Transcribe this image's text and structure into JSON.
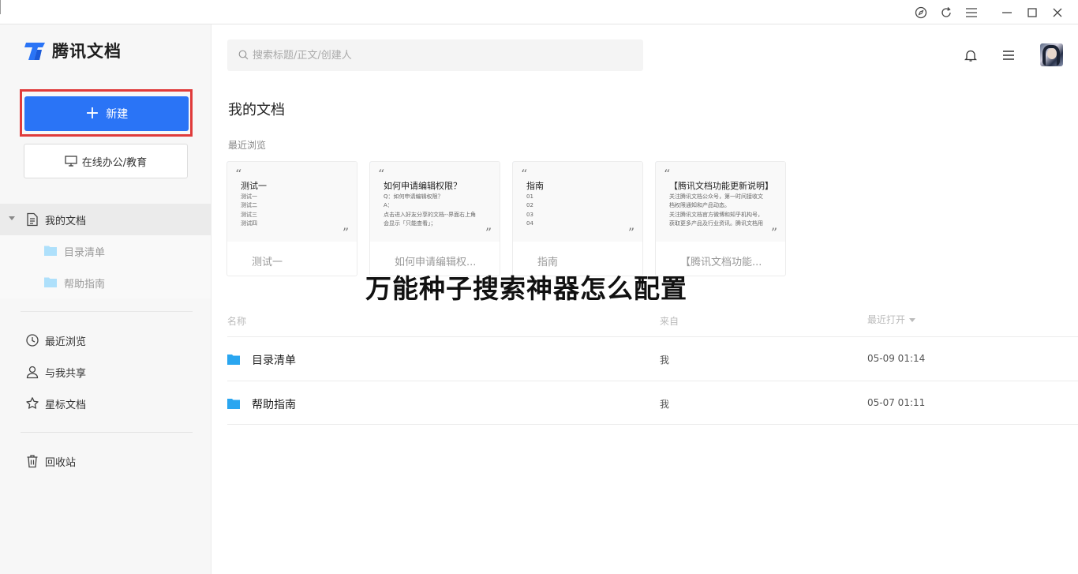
{
  "app": {
    "logo_text": "腾讯文档"
  },
  "sidebar": {
    "new_label": "新建",
    "online_label": "在线办公/教育",
    "my_docs": "我的文档",
    "folders": [
      {
        "label": "目录清单"
      },
      {
        "label": "帮助指南"
      }
    ],
    "recent": "最近浏览",
    "shared": "与我共享",
    "starred": "星标文档",
    "trash": "回收站"
  },
  "search": {
    "placeholder": "搜索标题/正文/创建人"
  },
  "main": {
    "title": "我的文档",
    "recent_label": "最近浏览",
    "cards": [
      {
        "title": "测试一",
        "lines": [
          "测试一",
          "测试二",
          "测试三",
          "测试四"
        ],
        "name": "测试一"
      },
      {
        "title": "如何申请编辑权限？",
        "lines": [
          "Q：如何申请编辑权限？",
          "A：",
          "点击进入好友分享的文档--界面右上角",
          "会显示「只能查看」；"
        ],
        "name": "如何申请编辑权..."
      },
      {
        "title": "指南",
        "lines": [
          "01",
          "02",
          "03",
          "04"
        ],
        "name": "指南"
      },
      {
        "title": "【腾讯文档功能更新说明】",
        "lines": [
          "关注腾讯文档公众号，第一时间接收文",
          "档权限通知和产品动态。",
          "关注腾讯文档官方微博和知乎机构号，",
          "获取更多产品及行业资讯。腾讯文档用"
        ],
        "name": "【腾讯文档功能..."
      }
    ],
    "overlay_text": "万能种子搜索神器怎么配置",
    "columns": {
      "name": "名称",
      "source": "来自",
      "last_opened": "最近打开"
    },
    "rows": [
      {
        "name": "目录清单",
        "source": "我",
        "time": "05-09 01:14"
      },
      {
        "name": "帮助指南",
        "source": "我",
        "time": "05-07 01:11"
      }
    ]
  },
  "colors": {
    "accent": "#2a74f6",
    "highlight_border": "#e03b3b",
    "folder": "#2aa6f0"
  }
}
